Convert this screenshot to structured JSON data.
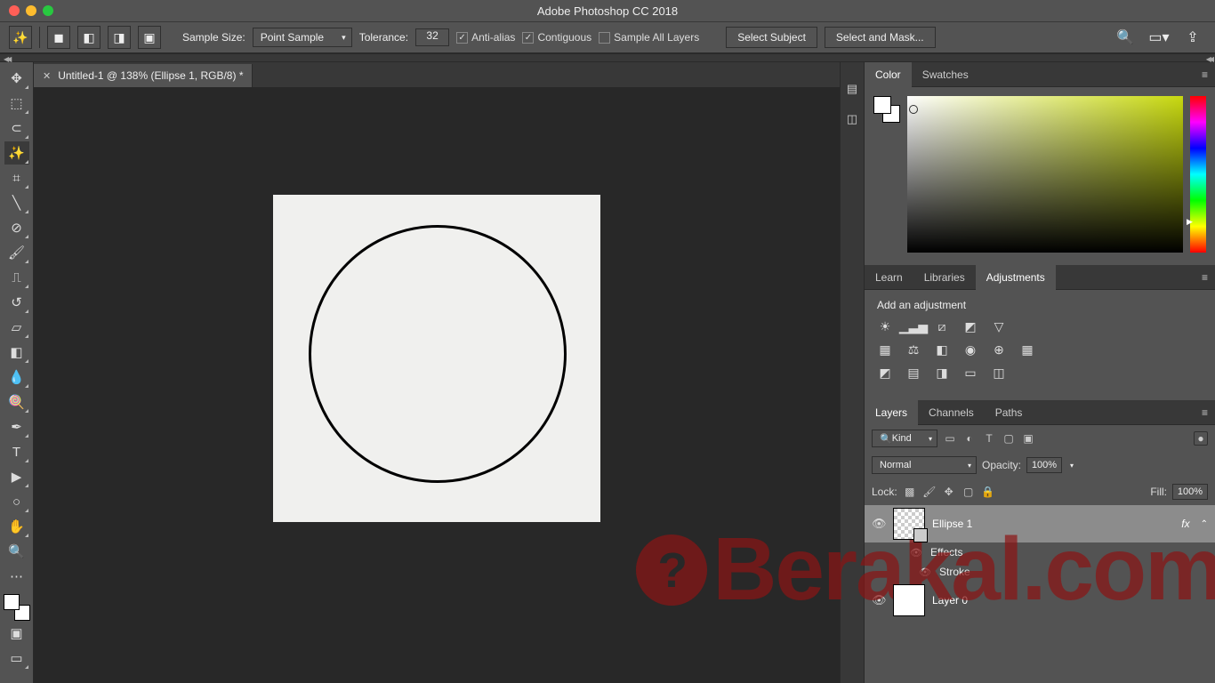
{
  "titlebar": {
    "title": "Adobe Photoshop CC 2018"
  },
  "options": {
    "sample_label": "Sample Size:",
    "sample_value": "Point Sample",
    "tolerance_label": "Tolerance:",
    "tolerance_value": "32",
    "antialias": "Anti-alias",
    "contiguous": "Contiguous",
    "sample_all": "Sample All Layers",
    "select_subject": "Select Subject",
    "select_mask": "Select and Mask..."
  },
  "doc": {
    "tab": "Untitled-1 @ 138% (Ellipse 1, RGB/8) *"
  },
  "panels": {
    "color": "Color",
    "swatches": "Swatches",
    "learn": "Learn",
    "libraries": "Libraries",
    "adjustments": "Adjustments",
    "add_adj": "Add an adjustment",
    "layers": "Layers",
    "channels": "Channels",
    "paths": "Paths"
  },
  "layers": {
    "kind": "Kind",
    "blend": "Normal",
    "opacity_lbl": "Opacity:",
    "opacity": "100%",
    "lock_lbl": "Lock:",
    "fill_lbl": "Fill:",
    "fill": "100%",
    "items": [
      {
        "name": "Ellipse 1",
        "fx": "fx",
        "effects": "Effects",
        "stroke": "Stroke"
      },
      {
        "name": "Layer 0"
      }
    ]
  },
  "watermark": "Berakal.com"
}
